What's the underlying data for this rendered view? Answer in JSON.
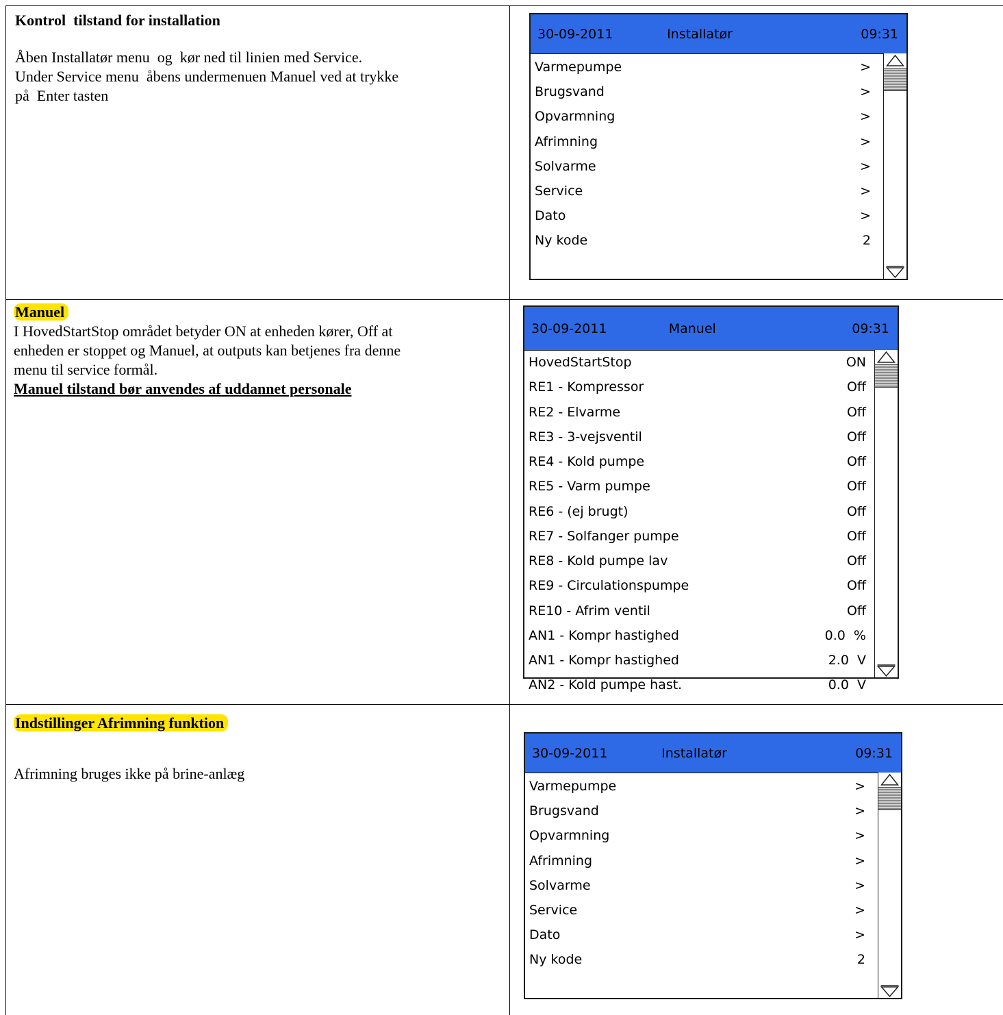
{
  "sections": [
    {
      "title": "Kontrol  tilstand for installation",
      "body": [
        "Åben Installatør menu  og  kør ned til linien med Service.",
        "Under Service menu  åbens undermenuen Manuel ved at trykke",
        "på  Enter tasten"
      ]
    },
    {
      "title": "Manuel",
      "body": [
        "I HovedStartStop området betyder ON at enheden kører, Off at",
        "enheden er stoppet og Manuel, at outputs kan betjenes fra denne",
        "menu til service formål."
      ],
      "warning": "Manuel tilstand bør anvendes af uddannet personale"
    },
    {
      "title": "Indstillinger Afrimning funktion",
      "body": [
        "Afrimning bruges ikke på brine-anlæg"
      ]
    }
  ],
  "screens": [
    {
      "date": "30-09-2011",
      "title": "Installatør",
      "time": "09:31",
      "rows": [
        {
          "label": "Varmepumpe",
          "value": ">"
        },
        {
          "label": "Brugsvand",
          "value": ">"
        },
        {
          "label": "Opvarmning",
          "value": ">"
        },
        {
          "label": "Afrimning",
          "value": ">"
        },
        {
          "label": "Solvarme",
          "value": ">"
        },
        {
          "label": "Service",
          "value": ">"
        },
        {
          "label": "Dato",
          "value": ">"
        },
        {
          "label": "Ny kode",
          "value": "2"
        }
      ]
    },
    {
      "date": "30-09-2011",
      "title": "Manuel",
      "time": "09:31",
      "rows": [
        {
          "label": "HovedStartStop",
          "value": "ON"
        },
        {
          "label": "RE1 - Kompressor",
          "value": "Off"
        },
        {
          "label": "RE2 - Elvarme",
          "value": "Off"
        },
        {
          "label": "RE3 - 3-vejsventil",
          "value": "Off"
        },
        {
          "label": "RE4 - Kold pumpe",
          "value": "Off"
        },
        {
          "label": "RE5 - Varm pumpe",
          "value": "Off"
        },
        {
          "label": "RE6 - (ej brugt)",
          "value": "Off"
        },
        {
          "label": "RE7 - Solfanger pumpe",
          "value": "Off"
        },
        {
          "label": "RE8 - Kold pumpe lav",
          "value": "Off"
        },
        {
          "label": "RE9 - Circulationspumpe",
          "value": "Off"
        },
        {
          "label": "RE10 - Afrim ventil",
          "value": "Off"
        },
        {
          "label": "AN1 - Kompr hastighed",
          "value": "0.0  %"
        },
        {
          "label": "AN1 - Kompr hastighed",
          "value": "2.0  V"
        },
        {
          "label": "AN2 - Kold pumpe hast.",
          "value": "0.0  V"
        }
      ]
    },
    {
      "date": "30-09-2011",
      "title": "Installatør",
      "time": "09:31",
      "rows": [
        {
          "label": "Varmepumpe",
          "value": ">"
        },
        {
          "label": "Brugsvand",
          "value": ">"
        },
        {
          "label": "Opvarmning",
          "value": ">"
        },
        {
          "label": "Afrimning",
          "value": ">"
        },
        {
          "label": "Solvarme",
          "value": ">"
        },
        {
          "label": "Service",
          "value": ">"
        },
        {
          "label": "Dato",
          "value": ">"
        },
        {
          "label": "Ny kode",
          "value": "2"
        }
      ]
    }
  ]
}
